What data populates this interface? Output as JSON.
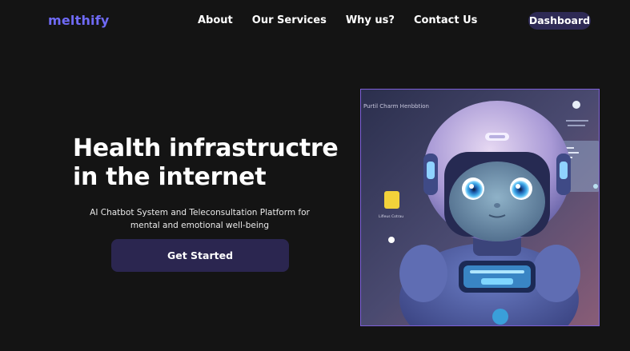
{
  "brand": {
    "logo_text": "melthify",
    "logo_color": "#6f6af7"
  },
  "nav": {
    "items": [
      {
        "label": "About"
      },
      {
        "label": "Our Services"
      },
      {
        "label": "Why us?"
      },
      {
        "label": "Contact Us"
      }
    ],
    "dashboard_label": "Dashboard"
  },
  "hero": {
    "headline_line1": "Health infrastructre",
    "headline_line2": "in the internet",
    "subtext": "AI Chatbot System and Teleconsultation Platform for mental and emotional well-being",
    "cta_label": "Get Started"
  },
  "image": {
    "caption_top": "Purtil Charm Henbbtion",
    "caption_left": "Lifleus Cotrau"
  },
  "colors": {
    "background": "#141414",
    "accent": "#6f6af7",
    "button": "#2b2650"
  }
}
